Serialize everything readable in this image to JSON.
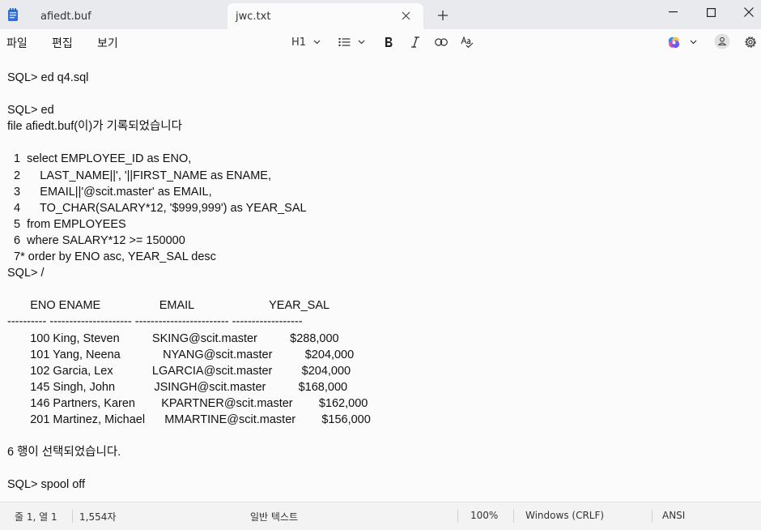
{
  "tabs": [
    {
      "title": "afiedt.buf"
    },
    {
      "title": "jwc.txt"
    }
  ],
  "menu": {
    "file": "파일",
    "edit": "편집",
    "view": "보기"
  },
  "toolbar": {
    "heading_label": "H1"
  },
  "editor": {
    "lines": [
      "SQL> ed q4.sql",
      "",
      "SQL> ed",
      "file afiedt.buf(이)가 기록되었습니다",
      "",
      "  1  select EMPLOYEE_ID as ENO,",
      "  2      LAST_NAME||', '||FIRST_NAME as ENAME,",
      "  3      EMAIL||'@scit.master' as EMAIL,",
      "  4      TO_CHAR(SALARY*12, '$999,999') as YEAR_SAL",
      "  5  from EMPLOYEES",
      "  6  where SALARY*12 >= 150000",
      "  7* order by ENO asc, YEAR_SAL desc",
      "SQL> /",
      "",
      "       ENO ENAME                  EMAIL                       YEAR_SAL",
      "---------- --------------------- ------------------------ ------------------",
      "       100 King, Steven          SKING@scit.master          $288,000",
      "       101 Yang, Neena             NYANG@scit.master          $204,000",
      "       102 Garcia, Lex            LGARCIA@scit.master         $204,000",
      "       145 Singh, John            JSINGH@scit.master          $168,000",
      "       146 Partners, Karen        KPARTNER@scit.master        $162,000",
      "       201 Martinez, Michael      MMARTINE@scit.master        $156,000",
      "",
      "6 행이 선택되었습니다.",
      "",
      "SQL> spool off"
    ]
  },
  "status": {
    "position": "줄 1, 열 1",
    "chars": "1,554자",
    "format": "일반 텍스트",
    "zoom": "100%",
    "line_ending": "Windows (CRLF)",
    "encoding": "ANSI"
  }
}
